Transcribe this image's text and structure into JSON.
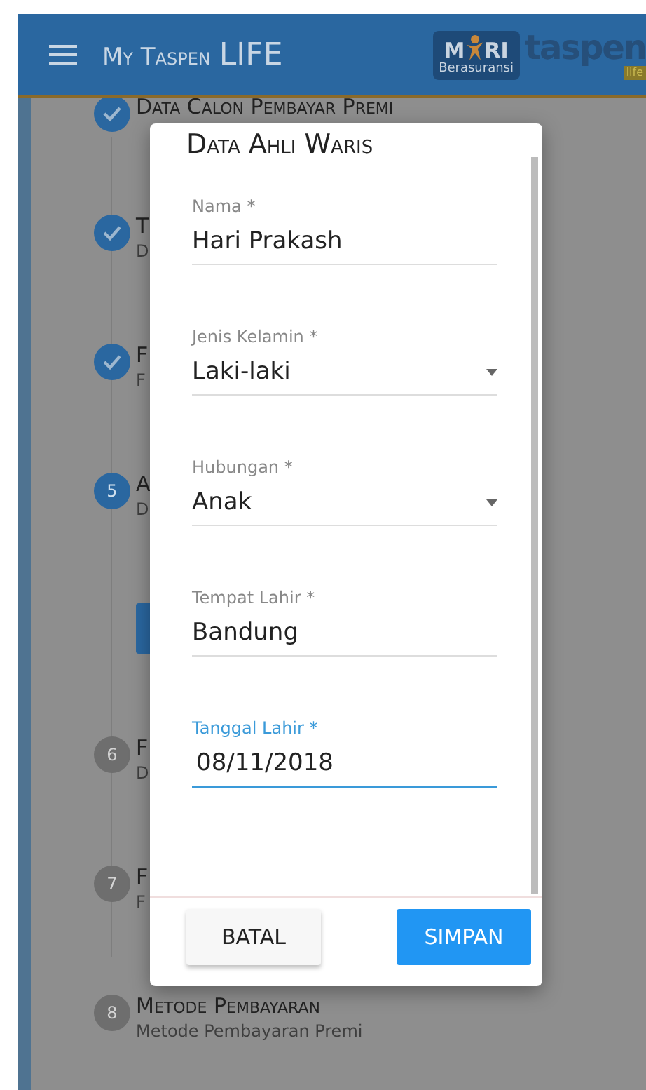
{
  "header": {
    "title_small": "My Taspen",
    "title_large": "LIFE",
    "logo": {
      "mari_left": "M",
      "mari_right": "RI",
      "tagline": "Berasuransi",
      "brand": "taspen",
      "brand_sub": "life"
    }
  },
  "steps": [
    {
      "kind": "done",
      "title": "Data Calon Pembayar Premi"
    },
    {
      "kind": "done",
      "title": "T",
      "subtitle": "D"
    },
    {
      "kind": "done",
      "title": "F",
      "subtitle": "F"
    },
    {
      "kind": "current",
      "number": "5",
      "title": "A",
      "subtitle": "D",
      "has_button": true
    },
    {
      "kind": "pending",
      "number": "6",
      "title": "F",
      "subtitle": "D"
    },
    {
      "kind": "pending",
      "number": "7",
      "title": "F",
      "subtitle": "F"
    },
    {
      "kind": "pending",
      "number": "8",
      "title": "Metode Pembayaran",
      "subtitle": "Metode Pembayaran Premi"
    }
  ],
  "dialog": {
    "title": "Data Ahli Waris",
    "fields": [
      {
        "kind": "text",
        "label": "Nama *",
        "value": "Hari Prakash",
        "focused": false
      },
      {
        "kind": "select",
        "label": "Jenis Kelamin *",
        "value": "Laki-laki",
        "focused": false
      },
      {
        "kind": "select",
        "label": "Hubungan *",
        "value": "Anak",
        "focused": false
      },
      {
        "kind": "text",
        "label": "Tempat Lahir *",
        "value": "Bandung",
        "focused": false
      },
      {
        "kind": "text",
        "label": "Tanggal Lahir *",
        "value": "08/11/2018",
        "focused": true
      }
    ],
    "buttons": [
      {
        "kind": "secondary",
        "label": "BATAL"
      },
      {
        "kind": "primary",
        "label": "SIMPAN"
      }
    ]
  }
}
